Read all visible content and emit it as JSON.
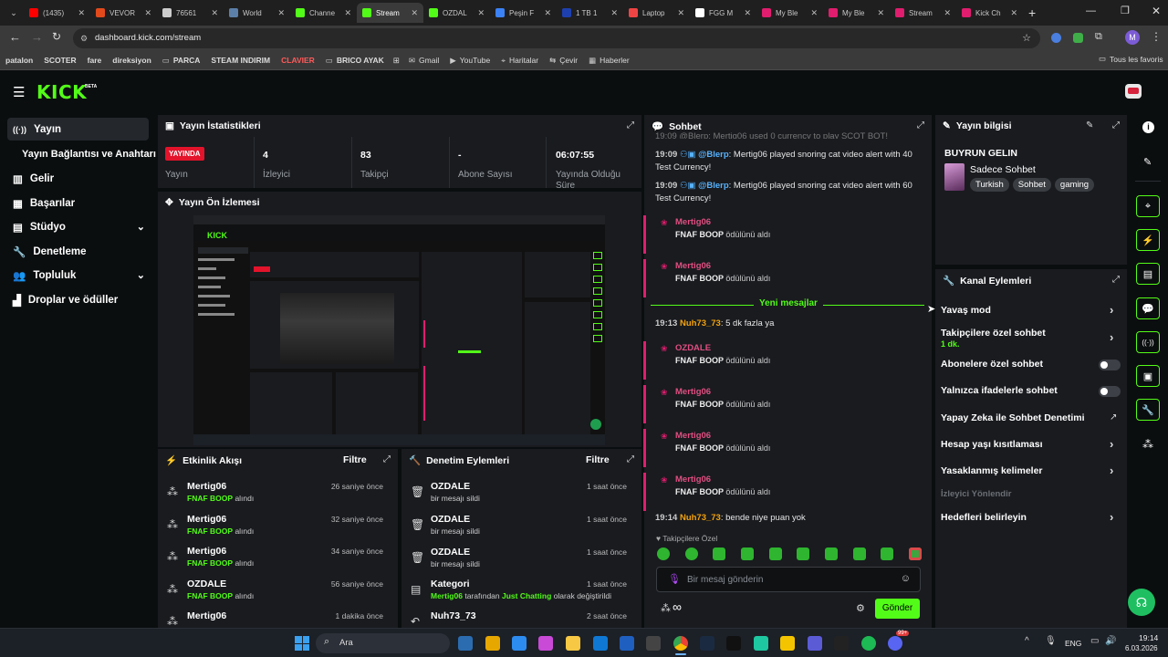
{
  "browser": {
    "tabs": [
      {
        "label": "(1435)",
        "color": "#ff0000"
      },
      {
        "label": "VEVOR",
        "color": "#e24a1c"
      },
      {
        "label": "76561",
        "color": "#cccccc"
      },
      {
        "label": "World",
        "color": "#5b7fa8"
      },
      {
        "label": "Channe",
        "color": "#53fc18"
      },
      {
        "label": "Stream",
        "color": "#53fc18"
      },
      {
        "label": "OZDAL",
        "color": "#53fc18"
      },
      {
        "label": "Peşin F",
        "color": "#3b82f6"
      },
      {
        "label": "1 TB 1",
        "color": "#1e40af"
      },
      {
        "label": "Laptop",
        "color": "#ef4444"
      },
      {
        "label": "FGG M",
        "color": "#ffffff"
      },
      {
        "label": "My Ble",
        "color": "#e01d6e"
      },
      {
        "label": "My Ble",
        "color": "#e01d6e"
      },
      {
        "label": "Stream",
        "color": "#e01d6e"
      },
      {
        "label": "Kick Ch",
        "color": "#e01d6e"
      }
    ],
    "url": "dashboard.kick.com/stream",
    "bookmarks": [
      "patalon",
      "SCOTER",
      "fare",
      "direksiyon",
      "PARCA",
      "STEAM INDIRIM",
      "CLAVIER",
      "BRICO AYAK",
      "Gmail",
      "YouTube",
      "Haritalar",
      "Çevir",
      "Haberler"
    ],
    "all_favorites": "Tous les favoris"
  },
  "header": {
    "logo": "KICK",
    "beta": "BETA"
  },
  "sidebar": {
    "items": [
      {
        "label": "Yayın",
        "icon": "stream-icon"
      },
      {
        "label": "Yayın Bağlantısı ve Anahtarı",
        "icon": ""
      },
      {
        "label": "Gelir",
        "icon": "revenue-icon"
      },
      {
        "label": "Başarılar",
        "icon": "achievements-icon"
      },
      {
        "label": "Stüdyo",
        "icon": "studio-icon"
      },
      {
        "label": "Denetleme",
        "icon": "moderation-icon"
      },
      {
        "label": "Topluluk",
        "icon": "community-icon"
      },
      {
        "label": "Droplar ve ödüller",
        "icon": "drops-icon"
      }
    ]
  },
  "stats": {
    "title": "Yayın İstatistikleri",
    "live_badge": "YAYINDA",
    "live_label": "Yayın",
    "viewers": "4",
    "viewers_label": "İzleyici",
    "followers": "83",
    "followers_label": "Takipçi",
    "subs": "-",
    "subs_label": "Abone Sayısı",
    "uptime": "06:07:55",
    "uptime_label": "Yayında Olduğu Süre"
  },
  "preview": {
    "title": "Yayın Ön İzlemesi"
  },
  "activity": {
    "title": "Etkinlik Akışı",
    "filter": "Filtre",
    "rows": [
      {
        "name": "Mertig06",
        "reward": "FNAF BOOP",
        "verb": "alındı",
        "time": "26 saniye önce"
      },
      {
        "name": "Mertig06",
        "reward": "FNAF BOOP",
        "verb": "alındı",
        "time": "32 saniye önce"
      },
      {
        "name": "Mertig06",
        "reward": "FNAF BOOP",
        "verb": "alındı",
        "time": "34 saniye önce"
      },
      {
        "name": "OZDALE",
        "reward": "FNAF BOOP",
        "verb": "alındı",
        "time": "56 saniye önce"
      },
      {
        "name": "Mertig06",
        "reward": "",
        "verb": "",
        "time": "1 dakika önce"
      }
    ]
  },
  "moderation": {
    "title": "Denetim Eylemleri",
    "filter": "Filtre",
    "rows": [
      {
        "name": "OZDALE",
        "text": "bir mesajı sildi",
        "time": "1 saat önce"
      },
      {
        "name": "OZDALE",
        "text": "bir mesajı sildi",
        "time": "1 saat önce"
      },
      {
        "name": "OZDALE",
        "text": "bir mesajı sildi",
        "time": "1 saat önce"
      },
      {
        "name": "Kategori",
        "text_user": "Mertig06",
        "text_mid": "tarafından",
        "text_cat": "Just Chatting",
        "text_end": "olarak değiştirildi",
        "time": "1 saat önce"
      },
      {
        "name": "Nuh73_73",
        "text": "",
        "time": "2 saat önce"
      }
    ]
  },
  "chat": {
    "title": "Sohbet",
    "top_line": "19:09 @Blerp: Mertig06 used 0 currency to play SCOT BOT!",
    "msg1": {
      "time": "19:09",
      "user": "@Blerp",
      "text": ": Mertig06 played snoring cat video alert with 40 Test Currency!"
    },
    "msg2": {
      "time": "19:09",
      "user": "@Blerp",
      "text": ": Mertig06 played snoring cat video alert with 60 Test Currency!"
    },
    "redemptions_a": [
      {
        "user": "Mertig06",
        "reward": "FNAF BOOP",
        "verb": "ödülünü aldı"
      },
      {
        "user": "Mertig06",
        "reward": "FNAF BOOP",
        "verb": "ödülünü aldı"
      }
    ],
    "new_messages": "Yeni mesajlar",
    "msg3": {
      "time": "19:13",
      "user": "Nuh73_73",
      "text": ": 5 dk fazla ya"
    },
    "redemptions_b": [
      {
        "user": "OZDALE",
        "reward": "FNAF BOOP",
        "verb": "ödülünü aldı"
      },
      {
        "user": "Mertig06",
        "reward": "FNAF BOOP",
        "verb": "ödülünü aldı"
      },
      {
        "user": "Mertig06",
        "reward": "FNAF BOOP",
        "verb": "ödülünü aldı"
      },
      {
        "user": "Mertig06",
        "reward": "FNAF BOOP",
        "verb": "ödülünü aldı"
      }
    ],
    "msg4": {
      "time": "19:14",
      "user": "Nuh73_73",
      "text": ": bende niye puan yok"
    },
    "followers_only": "Takipçilere Özel",
    "input_placeholder": "Bir mesaj gönderin",
    "send": "Gönder",
    "points": "∞"
  },
  "stream_info": {
    "title": "Yayın bilgisi",
    "stream_title": "BUYRUN GELIN",
    "category": "Sadece Sohbet",
    "tags": [
      "Turkish",
      "Sohbet",
      "gaming"
    ]
  },
  "channel_actions": {
    "title": "Kanal Eylemleri",
    "slow_mode": "Yavaş mod",
    "followers_only": "Takipçilere özel sohbet",
    "followers_only_value": "1 dk.",
    "subs_only": "Abonelere özel sohbet",
    "emotes_only": "Yalnızca ifadelerle sohbet",
    "ai_mod": "Yapay Zeka ile Sohbet Denetimi",
    "age": "Hesap yaşı kısıtlaması",
    "banned_words": "Yasaklanmış kelimeler",
    "raid": "İzleyici Yönlendir",
    "goals": "Hedefleri belirleyin"
  },
  "taskbar": {
    "search": "Ara",
    "lang": "ENG",
    "time": "19:14",
    "date": "6.03.2026",
    "badge": "99+"
  },
  "colors": {
    "accent": "#53fc18",
    "live": "#e3132b",
    "redeem": "#e01d6e",
    "blerp": "#57b3ff",
    "nuh": "#f2a20c"
  }
}
